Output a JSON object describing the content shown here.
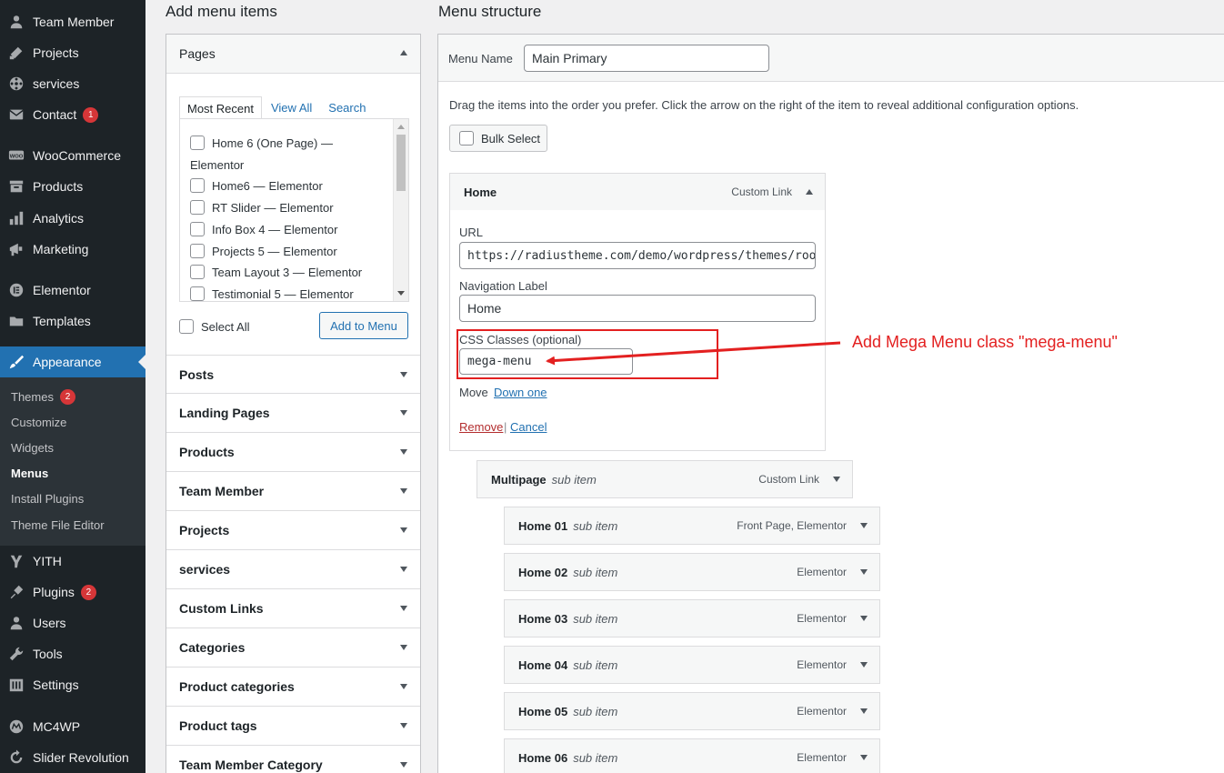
{
  "sidebar": {
    "items": [
      {
        "label": "Team Member",
        "icon": "person-icon",
        "badge": ""
      },
      {
        "label": "Projects",
        "icon": "portfolio-icon",
        "badge": ""
      },
      {
        "label": "services",
        "icon": "services-icon",
        "badge": ""
      },
      {
        "label": "Contact",
        "icon": "email-icon",
        "badge": "1"
      },
      {
        "label": "WooCommerce",
        "icon": "woo-icon",
        "badge": ""
      },
      {
        "label": "Products",
        "icon": "archive-icon",
        "badge": ""
      },
      {
        "label": "Analytics",
        "icon": "bar-chart-icon",
        "badge": ""
      },
      {
        "label": "Marketing",
        "icon": "megaphone-icon",
        "badge": ""
      },
      {
        "label": "Elementor",
        "icon": "elementor-icon",
        "badge": ""
      },
      {
        "label": "Templates",
        "icon": "folder-icon",
        "badge": ""
      },
      {
        "label": "Appearance",
        "icon": "paintbrush-icon",
        "badge": ""
      },
      {
        "label": "YITH",
        "icon": "yith-icon",
        "badge": ""
      },
      {
        "label": "Plugins",
        "icon": "plug-icon",
        "badge": "2"
      },
      {
        "label": "Users",
        "icon": "users-icon",
        "badge": ""
      },
      {
        "label": "Tools",
        "icon": "wrench-icon",
        "badge": ""
      },
      {
        "label": "Settings",
        "icon": "settings-icon",
        "badge": ""
      },
      {
        "label": "MC4WP",
        "icon": "mc4wp-icon",
        "badge": ""
      },
      {
        "label": "Slider Revolution",
        "icon": "refresh-icon",
        "badge": ""
      }
    ],
    "submenu": [
      {
        "label": "Themes",
        "badge": "2"
      },
      {
        "label": "Customize",
        "badge": ""
      },
      {
        "label": "Widgets",
        "badge": ""
      },
      {
        "label": "Menus",
        "badge": ""
      },
      {
        "label": "Install Plugins",
        "badge": ""
      },
      {
        "label": "Theme File Editor",
        "badge": ""
      }
    ]
  },
  "add_items": {
    "heading": "Add menu items",
    "pages_title": "Pages",
    "tabs": [
      "Most Recent",
      "View All",
      "Search"
    ],
    "pages": [
      {
        "name": "Home 6 (One Page) —",
        "suffix": "Elementor"
      },
      {
        "name": "Home6 —",
        "suffix": "Elementor"
      },
      {
        "name": "RT Slider —",
        "suffix": "Elementor"
      },
      {
        "name": "Info Box 4 —",
        "suffix": "Elementor"
      },
      {
        "name": "Projects 5 —",
        "suffix": "Elementor"
      },
      {
        "name": "Team Layout 3 —",
        "suffix": "Elementor"
      },
      {
        "name": "Testimonial 5 —",
        "suffix": "Elementor"
      }
    ],
    "select_all": "Select All",
    "add_button": "Add to Menu",
    "sections": [
      "Posts",
      "Landing Pages",
      "Products",
      "Team Member",
      "Projects",
      "services",
      "Custom Links",
      "Categories",
      "Product categories",
      "Product tags",
      "Team Member Category"
    ]
  },
  "structure": {
    "heading": "Menu structure",
    "menu_name_label": "Menu Name",
    "menu_name_value": "Main Primary",
    "instructions": "Drag the items into the order you prefer. Click the arrow on the right of the item to reveal additional configuration options.",
    "bulk_select": "Bulk Select",
    "home": {
      "title": "Home",
      "type": "Custom Link",
      "url_label": "URL",
      "url_value": "https://radiustheme.com/demo/wordpress/themes/roofix",
      "nav_label": "Navigation Label",
      "nav_value": "Home",
      "css_label": "CSS Classes (optional)",
      "css_value": "mega-menu",
      "move_label": "Move",
      "move_link": "Down one",
      "remove": "Remove",
      "separator": "|",
      "cancel": "Cancel"
    },
    "items": [
      {
        "title": "Multipage",
        "sub": "sub item",
        "type": "Custom Link"
      },
      {
        "title": "Home 01",
        "sub": "sub item",
        "type": "Front Page, Elementor"
      },
      {
        "title": "Home 02",
        "sub": "sub item",
        "type": "Elementor"
      },
      {
        "title": "Home 03",
        "sub": "sub item",
        "type": "Elementor"
      },
      {
        "title": "Home 04",
        "sub": "sub item",
        "type": "Elementor"
      },
      {
        "title": "Home 05",
        "sub": "sub item",
        "type": "Elementor"
      },
      {
        "title": "Home 06",
        "sub": "sub item",
        "type": "Elementor"
      }
    ]
  },
  "annotation": {
    "text": "Add Mega Menu class \"mega-menu\"",
    "color": "#e32020"
  },
  "colors": {
    "admin_bar": "#1d2327",
    "accent": "#2271b1",
    "badge": "#d63638"
  }
}
